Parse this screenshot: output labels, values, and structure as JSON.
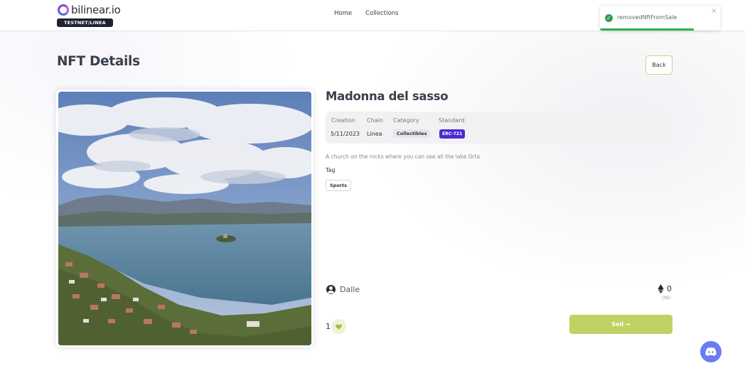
{
  "brand": {
    "name": "bilinear.io",
    "network_badge": "TESTNET/LINEA"
  },
  "nav": {
    "home": "Home",
    "collections": "Collections"
  },
  "toast": {
    "message": "removedNftFromSale",
    "close": "×",
    "progress": 0.78
  },
  "page": {
    "title": "NFT Details",
    "back_label": "Back"
  },
  "nft": {
    "name": "Madonna del sasso",
    "meta": {
      "creation_label": "Creation",
      "creation_value": "5/11/2023",
      "chain_label": "Chain",
      "chain_value": "Linea",
      "category_label": "Category",
      "category_value": "Collectibles",
      "standard_label": "Standard",
      "standard_value": "ERC-721"
    },
    "description": "A church on the rocks where you can see all the lake Orta",
    "tag_label": "Tag",
    "tags": [
      "Sports"
    ],
    "owner": "Dalle",
    "price": "0",
    "price_usd": "(0$)",
    "likes": "1",
    "sell_label": "Sell →"
  },
  "colors": {
    "accent": "#c2d164",
    "badge_purple": "#4b2bd1",
    "toast_green": "#2eb34e",
    "discord": "#6a7df0"
  },
  "icons": {
    "logo": "bilinear-ring-icon",
    "toast": "check-circle-icon",
    "owner": "user-circle-icon",
    "price": "ethereum-icon",
    "like": "heart-icon",
    "chat": "discord-icon"
  }
}
